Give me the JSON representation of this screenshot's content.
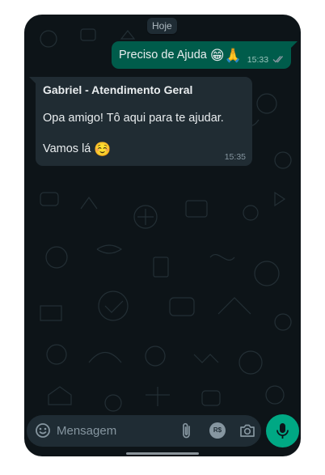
{
  "chat": {
    "date_label": "Hoje",
    "outgoing": {
      "text": "Preciso de Ajuda",
      "emojis": "😁🙏",
      "time": "15:33",
      "status": "read"
    },
    "incoming": {
      "sender": "Gabriel - Atendimento Geral",
      "line1": "Opa amigo! Tô aqui para te ajudar.",
      "line2": "Vamos lá",
      "emoji": "☺️",
      "time": "15:35"
    }
  },
  "composer": {
    "placeholder": "Mensagem",
    "payment_label": "R$"
  },
  "colors": {
    "background": "#0d1418",
    "outgoing_bubble": "#005c4b",
    "incoming_bubble": "#202c33",
    "accent": "#00a884"
  }
}
